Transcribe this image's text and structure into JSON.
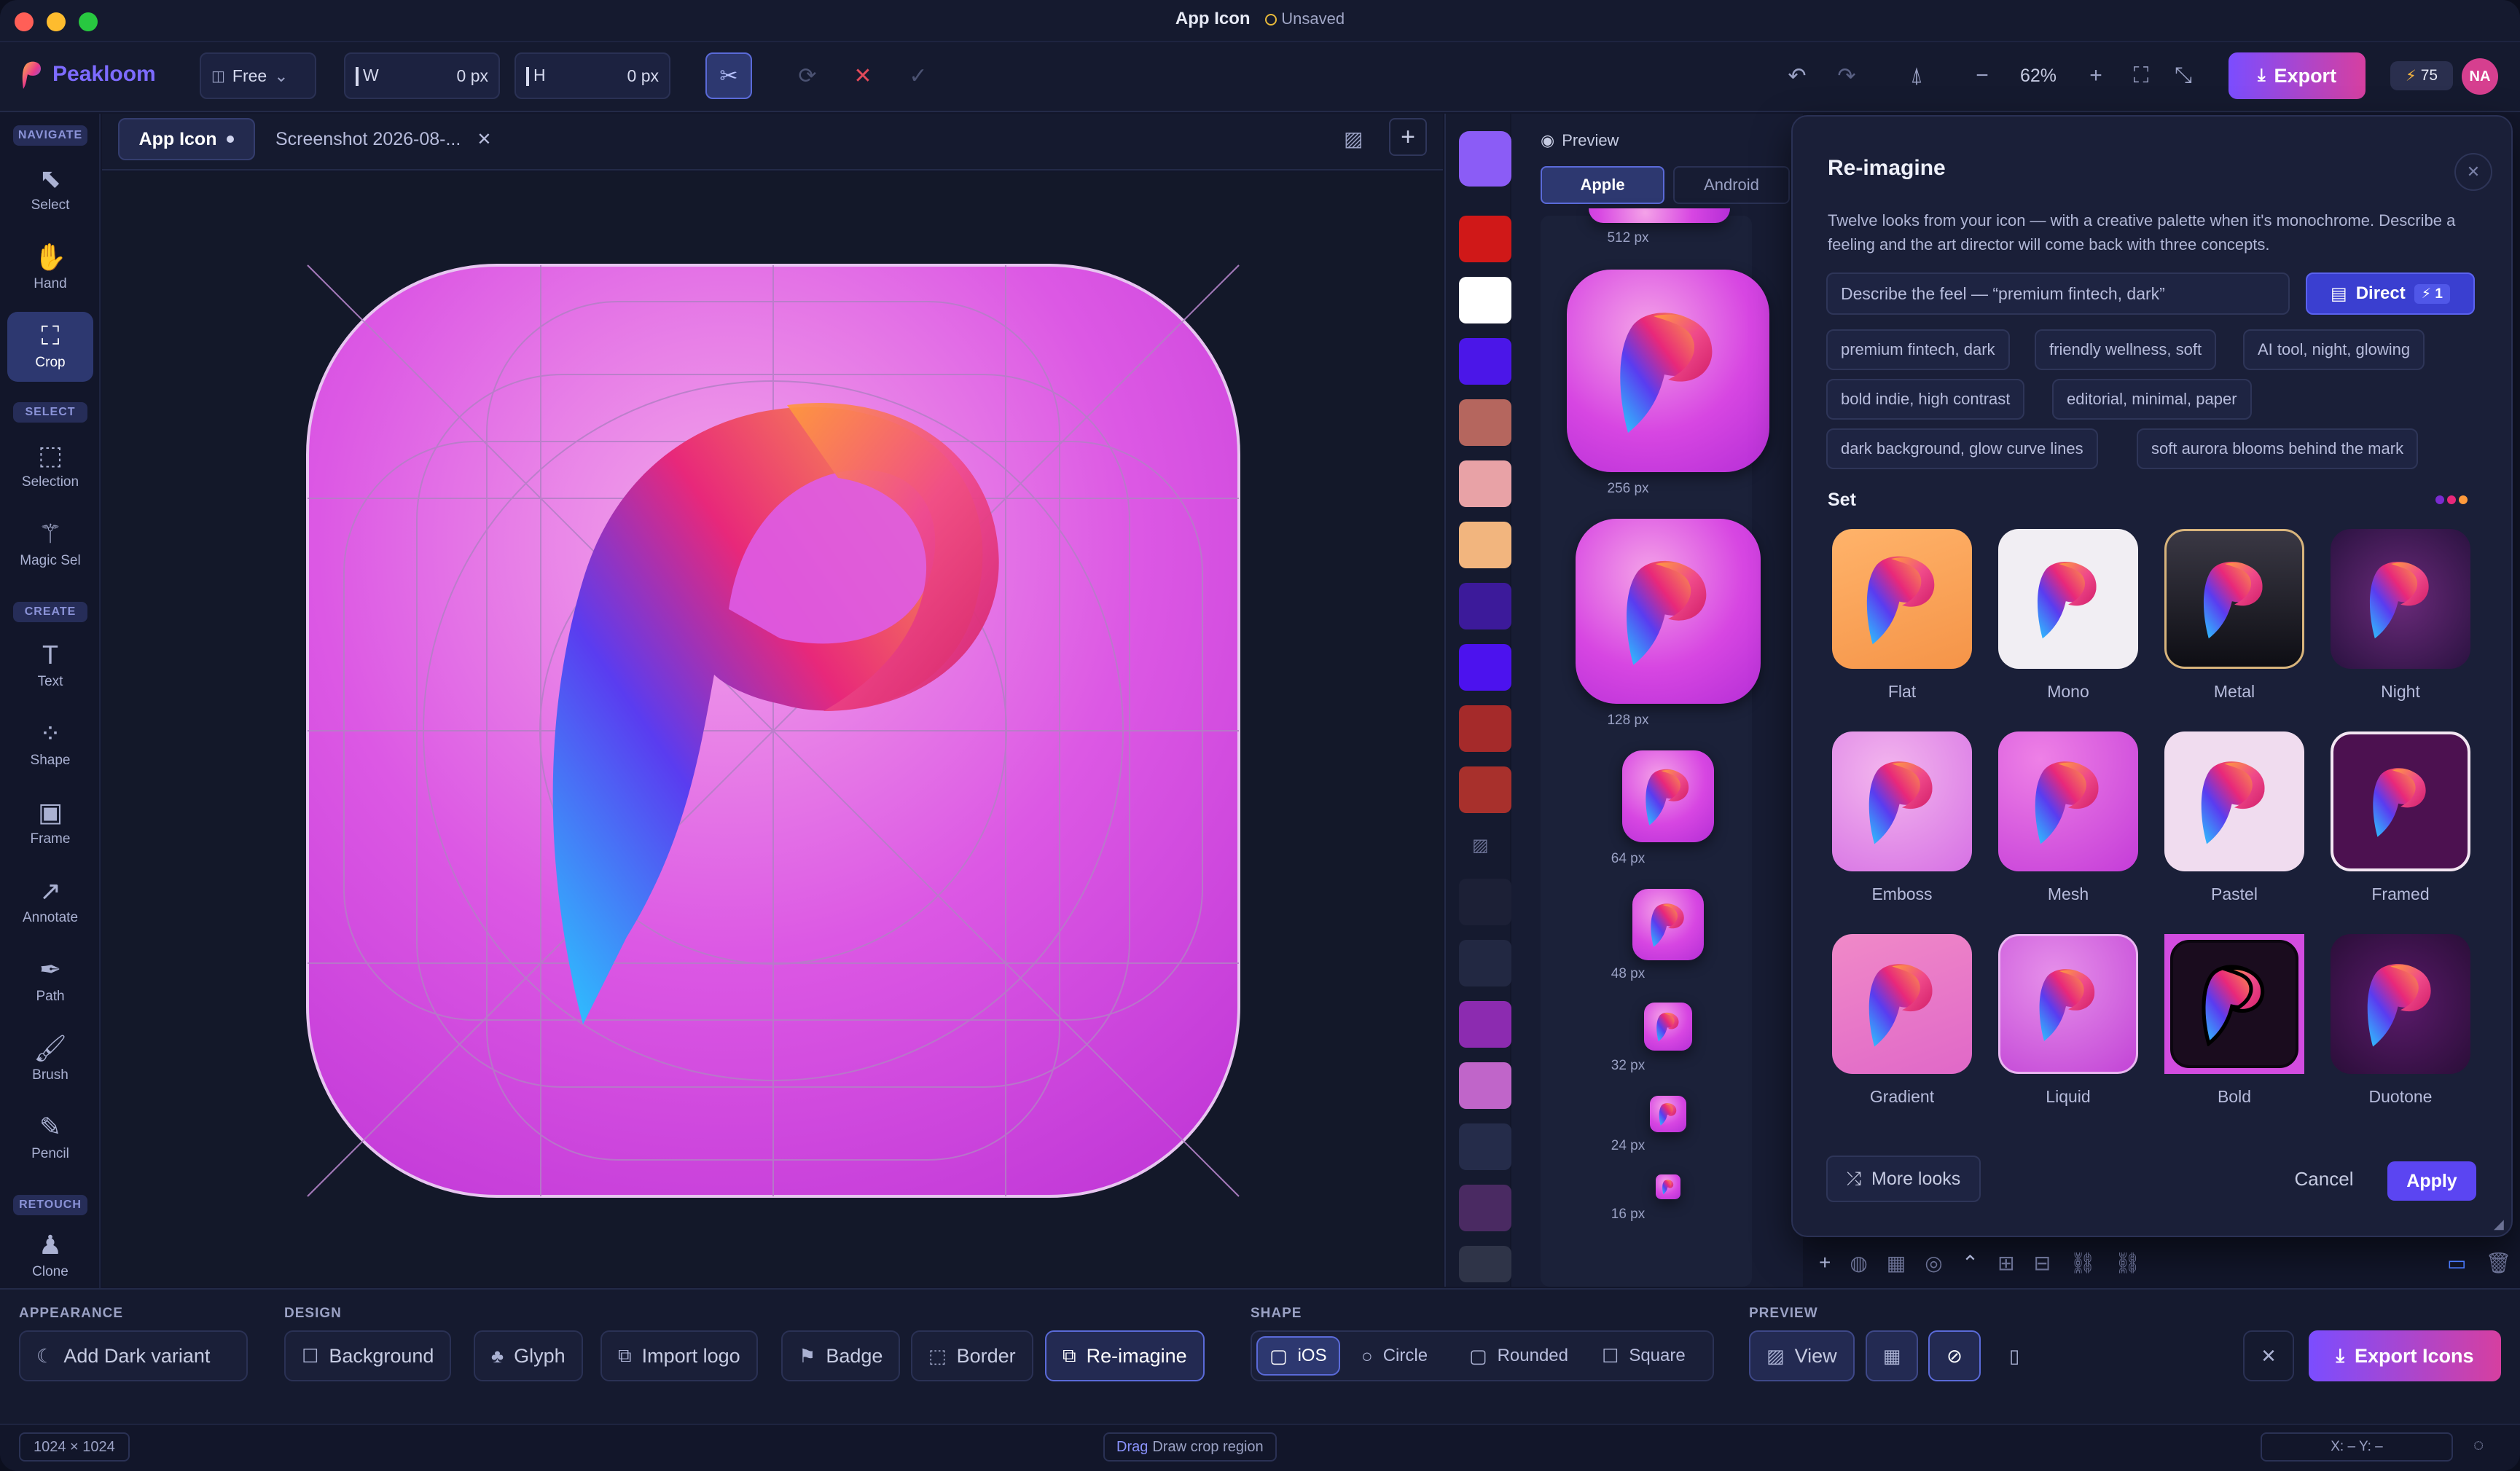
{
  "window": {
    "title": "App Icon",
    "save_state": "Unsaved"
  },
  "toolbar": {
    "brand": "Peakloom",
    "mode_dropdown": "Free",
    "width_label": "W",
    "width_value": "0 px",
    "height_label": "H",
    "height_value": "0 px",
    "zoom": "62%",
    "export_label": "Export",
    "credits": "75",
    "avatar": "NA"
  },
  "rail": {
    "sections": {
      "navigate": "NAVIGATE",
      "select": "SELECT",
      "create": "CREATE",
      "retouch": "RETOUCH"
    },
    "tools": [
      {
        "label": "Select",
        "icon": "cursor-icon"
      },
      {
        "label": "Hand",
        "icon": "hand-icon"
      },
      {
        "label": "Crop",
        "icon": "crop-icon"
      },
      {
        "label": "Selection",
        "icon": "marquee-icon"
      },
      {
        "label": "Magic Sel",
        "icon": "magic-wand-icon"
      },
      {
        "label": "Text",
        "icon": "text-icon"
      },
      {
        "label": "Shape",
        "icon": "shape-icon"
      },
      {
        "label": "Frame",
        "icon": "frame-icon"
      },
      {
        "label": "Annotate",
        "icon": "arrow-icon"
      },
      {
        "label": "Path",
        "icon": "pen-icon"
      },
      {
        "label": "Brush",
        "icon": "brush-icon"
      },
      {
        "label": "Pencil",
        "icon": "pencil-icon"
      },
      {
        "label": "Clone",
        "icon": "stamp-icon"
      }
    ],
    "active_tool": "Crop"
  },
  "tabs": [
    {
      "label": "App Icon",
      "active": true
    },
    {
      "label": "Screenshot 2026-08-...",
      "active": false
    }
  ],
  "swatches": [
    "#8b5cf6",
    "#d01818",
    "#ffffff",
    "#4b16e8",
    "#b5665e",
    "#e8a2a6",
    "#f2b57e",
    "#3c1a9a",
    "#4c12ee",
    "#a52a2a",
    "#a8302c",
    "#1c2036",
    "#222842",
    "#8c2bb0",
    "#c065c9",
    "#252c4a",
    "#4a2a62",
    "#2f3448"
  ],
  "preview": {
    "title": "Preview",
    "platform_tabs": [
      "Apple",
      "Android"
    ],
    "active_platform": "Apple",
    "sizes": [
      "512 px",
      "256 px",
      "128 px",
      "64 px",
      "48 px",
      "32 px",
      "24 px",
      "16 px"
    ]
  },
  "reimagine": {
    "title": "Re-imagine",
    "description": "Twelve looks from your icon — with a creative palette when it's monochrome. Describe a feeling and the art director will come back with three concepts.",
    "prompt_placeholder": "Describe the feel — “premium fintech, dark”",
    "direct_label": "Direct",
    "direct_cost": "1",
    "suggestions": [
      "premium fintech, dark",
      "friendly wellness, soft",
      "AI tool, night, glowing",
      "bold indie, high contrast",
      "editorial, minimal, paper",
      "dark background, glow curve lines",
      "soft aurora blooms behind the mark"
    ],
    "set_label": "Set",
    "looks": [
      "Flat",
      "Mono",
      "Metal",
      "Night",
      "Emboss",
      "Mesh",
      "Pastel",
      "Framed",
      "Gradient",
      "Liquid",
      "Bold",
      "Duotone"
    ],
    "selected_look": "Bold",
    "more_looks": "More looks",
    "cancel": "Cancel",
    "apply": "Apply"
  },
  "bottom": {
    "appearance": {
      "label": "APPEARANCE",
      "add_dark": "Add Dark variant"
    },
    "design": {
      "label": "DESIGN",
      "items": [
        "Background",
        "Glyph",
        "Import logo",
        "Badge",
        "Border",
        "Re-imagine"
      ],
      "active": "Re-imagine"
    },
    "shape": {
      "label": "SHAPE",
      "items": [
        "iOS",
        "Circle",
        "Rounded",
        "Square"
      ],
      "active": "iOS"
    },
    "preview": {
      "label": "PREVIEW",
      "view": "View"
    },
    "export_icons": "Export Icons"
  },
  "status": {
    "dimensions": "1024 × 1024",
    "hint_key": "Drag",
    "hint_text": "Draw crop region",
    "coords": "X: –  Y: –"
  },
  "colors": {
    "accent": "#7b4dff",
    "accent_pink": "#e0409a",
    "bg": "#12162a"
  }
}
